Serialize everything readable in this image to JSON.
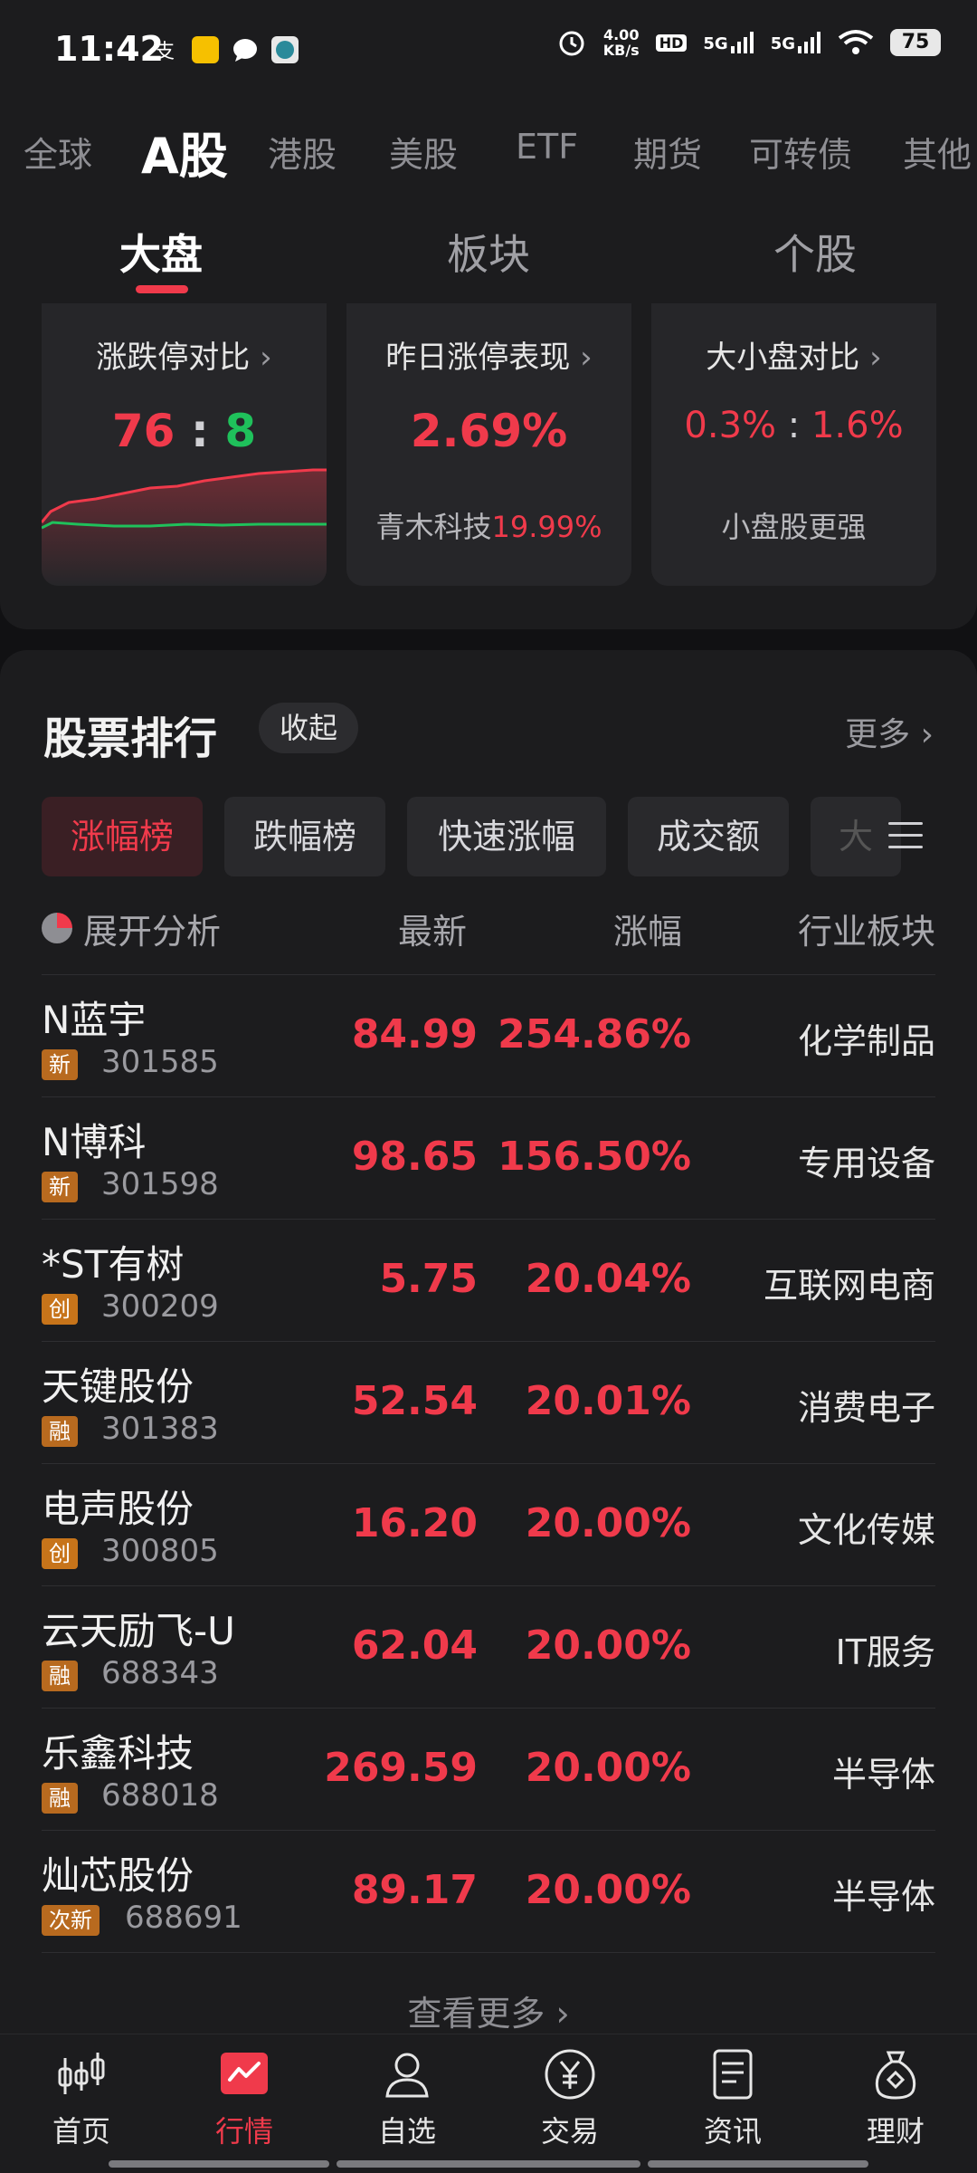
{
  "status_bar": {
    "time": "11:42",
    "net_speed_value": "4.00",
    "net_speed_unit": "KB/s",
    "hd": "HD",
    "sig1": "5G",
    "sig2": "5G",
    "battery": "75"
  },
  "market_tabs": [
    "全球",
    "A股",
    "港股",
    "美股",
    "ETF",
    "期货",
    "可转债",
    "其他"
  ],
  "sub_tabs": [
    "大盘",
    "板块",
    "个股"
  ],
  "cards": {
    "limit": {
      "title": "涨跌停对比",
      "up": "76",
      "sep": ":",
      "down": "8"
    },
    "yesterday": {
      "title": "昨日涨停表现",
      "value": "2.69%",
      "stock": "青木科技",
      "stock_pct": "19.99%"
    },
    "cap": {
      "title": "大小盘对比",
      "big": "0.3%",
      "sep": ":",
      "small": "1.6%",
      "note": "小盘股更强"
    }
  },
  "ranking": {
    "title": "股票排行",
    "collapse": "收起",
    "more": "更多",
    "chips": [
      "涨幅榜",
      "跌幅榜",
      "快速涨幅",
      "成交额",
      "大"
    ],
    "headers": {
      "analysis": "展开分析",
      "latest": "最新",
      "change": "涨幅",
      "industry": "行业板块"
    },
    "rows": [
      {
        "name": "N蓝宇",
        "badge": "新",
        "code": "301585",
        "price": "84.99",
        "change": "254.86%",
        "industry": "化学制品"
      },
      {
        "name": "N博科",
        "badge": "新",
        "code": "301598",
        "price": "98.65",
        "change": "156.50%",
        "industry": "专用设备"
      },
      {
        "name": "*ST有树",
        "badge": "创",
        "code": "300209",
        "price": "5.75",
        "change": "20.04%",
        "industry": "互联网电商"
      },
      {
        "name": "天键股份",
        "badge": "融",
        "code": "301383",
        "price": "52.54",
        "change": "20.01%",
        "industry": "消费电子"
      },
      {
        "name": "电声股份",
        "badge": "创",
        "code": "300805",
        "price": "16.20",
        "change": "20.00%",
        "industry": "文化传媒"
      },
      {
        "name": "云天励飞-U",
        "badge": "融",
        "code": "688343",
        "price": "62.04",
        "change": "20.00%",
        "industry": "IT服务"
      },
      {
        "name": "乐鑫科技",
        "badge": "融",
        "code": "688018",
        "price": "269.59",
        "change": "20.00%",
        "industry": "半导体"
      },
      {
        "name": "灿芯股份",
        "badge": "次新",
        "code": "688691",
        "price": "89.17",
        "change": "20.00%",
        "industry": "半导体"
      }
    ],
    "see_more": "查看更多"
  },
  "bottom_nav": [
    "首页",
    "行情",
    "自选",
    "交易",
    "资讯",
    "理财"
  ],
  "colors": {
    "up": "#f03a4b",
    "down": "#1fc15b",
    "bg": "#1c1c1e"
  }
}
